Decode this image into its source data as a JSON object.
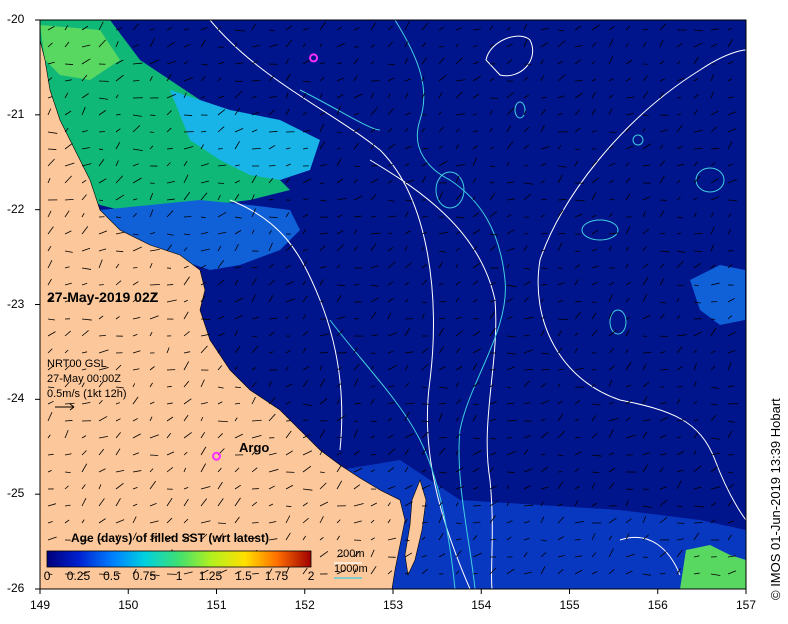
{
  "axes": {
    "lon_ticks": [
      "149",
      "150",
      "151",
      "152",
      "153",
      "154",
      "155",
      "156",
      "157"
    ],
    "lat_ticks": [
      "-20",
      "-21",
      "-22",
      "-23",
      "-24",
      "-25",
      "-26"
    ],
    "lon_range": [
      149,
      157
    ],
    "lat_range": [
      -26,
      -20
    ]
  },
  "title_stamp": "27-May-2019 02Z",
  "info": {
    "line1": "NRT00 GSL",
    "line2": "27-May 00:00Z",
    "line3": "0.5m/s (1kt 12h)"
  },
  "argo_label": "Argo",
  "argo_markers": [
    {
      "lon": 152.1,
      "lat": -20.4
    },
    {
      "lon": 151.0,
      "lat": -24.6
    }
  ],
  "colorbar": {
    "title": "Age (days) of filled SST (wrt latest)",
    "ticks": [
      "0",
      "0.25",
      "0.5",
      "0.75",
      "1",
      "1.25",
      "1.5",
      "1.75",
      "2"
    ],
    "range": [
      0,
      2
    ]
  },
  "isobath_legend": {
    "line1": "200m",
    "line2": "1000m",
    "color200": "#ffffff",
    "color1000": "#40d0e0"
  },
  "credit": "© IMOS 01-Jun-2019 13:39 Hobart",
  "colors": {
    "ocean_dark": "#00148c",
    "land": "#fcc79a",
    "green": "#10b878",
    "cyan": "#18b4e8",
    "blue": "#1060d8"
  }
}
